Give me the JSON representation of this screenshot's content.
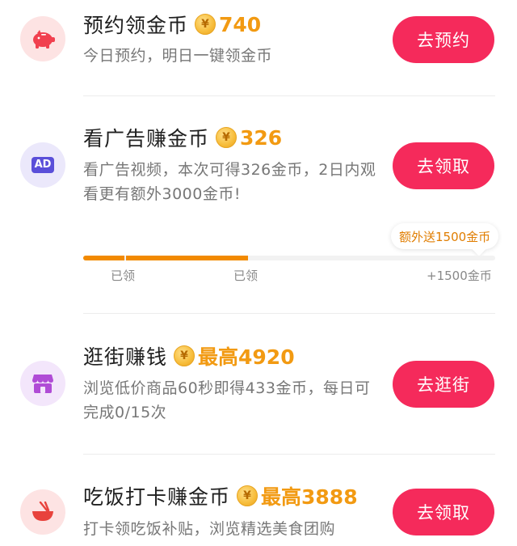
{
  "tasks": [
    {
      "title": "预约领金币",
      "reward": "740",
      "desc": "今日预约，明日一键领金币",
      "button": "去预约",
      "icon": "piggy-bank-icon"
    },
    {
      "title": "看广告赚金币",
      "reward": "326",
      "desc": "看广告视频，本次可得326金币，2日内观看更有额外3000金币!",
      "button": "去领取",
      "icon": "ad-icon",
      "icon_text": "AD"
    },
    {
      "title": "逛街赚钱",
      "reward": "最高4920",
      "desc": "浏览低价商品60秒即得433金币，每日可完成0/15次",
      "button": "去逛街",
      "icon": "shop-icon"
    },
    {
      "title": "吃饭打卡赚金币",
      "reward": "最高3888",
      "desc": "打卡领吃饭补贴，浏览精选美食团购",
      "button": "去领取",
      "icon": "food-bowl-icon"
    }
  ],
  "coin_symbol": "¥",
  "progress": {
    "tooltip": "额外送1500金币",
    "steps": [
      "已领",
      "已领",
      "+1500金币"
    ],
    "completed_steps": 2,
    "total_steps": 3,
    "fill_fraction": 0.4
  },
  "colors": {
    "button": "#f52a5b",
    "reward": "#f29a12",
    "progress_fill": "#f28a00"
  }
}
